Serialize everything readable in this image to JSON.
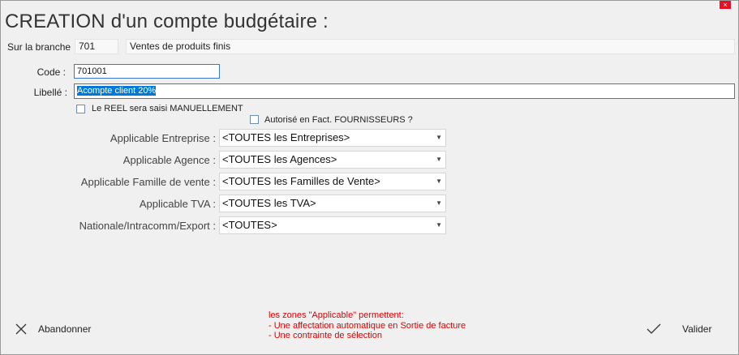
{
  "window": {
    "title": "CREATION d'un compte budgétaire :",
    "close_glyph": "×"
  },
  "branch": {
    "label": "Sur la branche",
    "code": "701",
    "name": "Ventes de produits finis"
  },
  "form": {
    "code_label": "Code :",
    "code_value": "701001",
    "libelle_label": "Libellé :",
    "libelle_value": "Acompte client 20%",
    "reel_checkbox_label": "Le REEL sera saisi MANUELLEMENT",
    "reel_checked": false,
    "fournisseurs_checkbox_label": "Autorisé en Fact. FOURNISSEURS ?",
    "fournisseurs_checked": false
  },
  "applicables": [
    {
      "label": "Applicable Entreprise :",
      "value": "<TOUTES les Entreprises>"
    },
    {
      "label": "Applicable Agence :",
      "value": "<TOUTES les Agences>"
    },
    {
      "label": "Applicable Famille de vente :",
      "value": "<TOUTES les Familles de Vente>"
    },
    {
      "label": "Applicable TVA :",
      "value": "<TOUTES les TVA>"
    },
    {
      "label": "Nationale/Intracomm/Export :",
      "value": "<TOUTES>"
    }
  ],
  "note": {
    "line1": "les zones \"Applicable\" permettent:",
    "line2": "- Une affectation automatique en Sortie de facture",
    "line3": "- Une contrainte de sélection",
    "color": "#e00000"
  },
  "buttons": {
    "cancel": {
      "label": "Abandonner",
      "icon": "close-icon"
    },
    "ok": {
      "label": "Valider",
      "icon": "checkmark-icon"
    }
  },
  "colors": {
    "selection": "#0078d7",
    "input_border": "#3c78c8",
    "close": "#e81123"
  }
}
